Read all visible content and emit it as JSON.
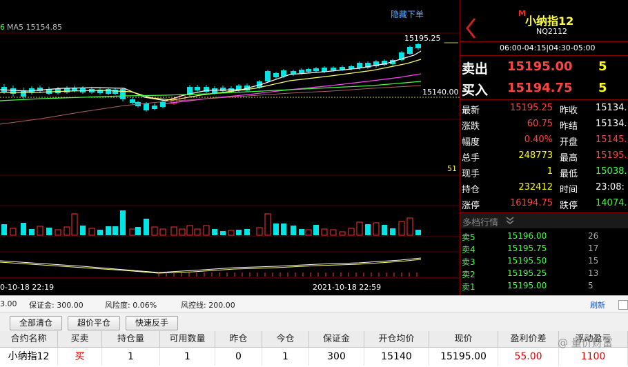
{
  "chart": {
    "ma5_prefix": "6",
    "ma5_label": "MA5 15154.85",
    "hide_order_label": "隐藏下单",
    "high_price_label": "15195.25",
    "ref_price_label": "15140.00",
    "volume_scale_label": "51",
    "time_left": "0-10-18 22:19",
    "time_right": "2021-10-18 22:59"
  },
  "quote": {
    "marker": "M",
    "name": "小纳指12",
    "code": "NQ2112",
    "session": "06:00-04:15|04:30-05:00",
    "sell": {
      "label": "卖出",
      "price": "15195.00",
      "qty": "5"
    },
    "buy": {
      "label": "买入",
      "price": "15194.75",
      "qty": "5"
    },
    "stats_left": [
      {
        "label": "最新",
        "value": "15195.25"
      },
      {
        "label": "涨跌",
        "value": "60.75"
      },
      {
        "label": "幅度",
        "value": "0.40%"
      },
      {
        "label": "总手",
        "value": "248773"
      },
      {
        "label": "现手",
        "value": "1"
      },
      {
        "label": "持仓",
        "value": "232412"
      },
      {
        "label": "涨停",
        "value": "16194.75"
      }
    ],
    "stats_right": [
      {
        "label": "昨收",
        "value": "15134."
      },
      {
        "label": "昨结",
        "value": "15134."
      },
      {
        "label": "开盘",
        "value": "15145."
      },
      {
        "label": "最高",
        "value": "15195."
      },
      {
        "label": "最低",
        "value": "15038."
      },
      {
        "label": "时间",
        "value": "23:08:"
      },
      {
        "label": "跌停",
        "value": "14074."
      }
    ],
    "depth_title": "多档行情",
    "depth": [
      {
        "label": "卖5",
        "price": "15196.00",
        "qty": "26"
      },
      {
        "label": "卖4",
        "price": "15195.75",
        "qty": "17"
      },
      {
        "label": "卖3",
        "price": "15195.50",
        "qty": "15"
      },
      {
        "label": "卖2",
        "price": "15195.25",
        "qty": "13"
      },
      {
        "label": "卖1",
        "price": "15195.00",
        "qty": "5"
      }
    ]
  },
  "status": {
    "cut_value": "3.00",
    "margin": "保证金: 300.00",
    "risk": "风险度: 0.06%",
    "risk_line": "风控线: 200.00",
    "refresh": "刷新"
  },
  "toolbar": {
    "close_all": "全部清仓",
    "close_over": "超价平仓",
    "reverse": "快速反手"
  },
  "positions": {
    "headers": [
      "合约名称",
      "买卖",
      "持仓量",
      "可用数量",
      "昨仓",
      "今仓",
      "保证金",
      "开仓均价",
      "现价",
      "盈利价差",
      "浮动盈亏"
    ],
    "row": [
      "小纳指12",
      "买",
      "1",
      "1",
      "0",
      "1",
      "300",
      "15140",
      "15195.00",
      "55.00",
      "1100"
    ]
  },
  "watermark": "@ 量价财富",
  "colors": {
    "up": "#ff3333",
    "down": "#00e5e5",
    "ma_white": "#ffffff",
    "ma_yellow": "#ffff66",
    "ma_magenta": "#ff44ff",
    "ma_green": "#44ff44",
    "price_red": "#ff4444",
    "qty_yellow": "#ffff00"
  }
}
